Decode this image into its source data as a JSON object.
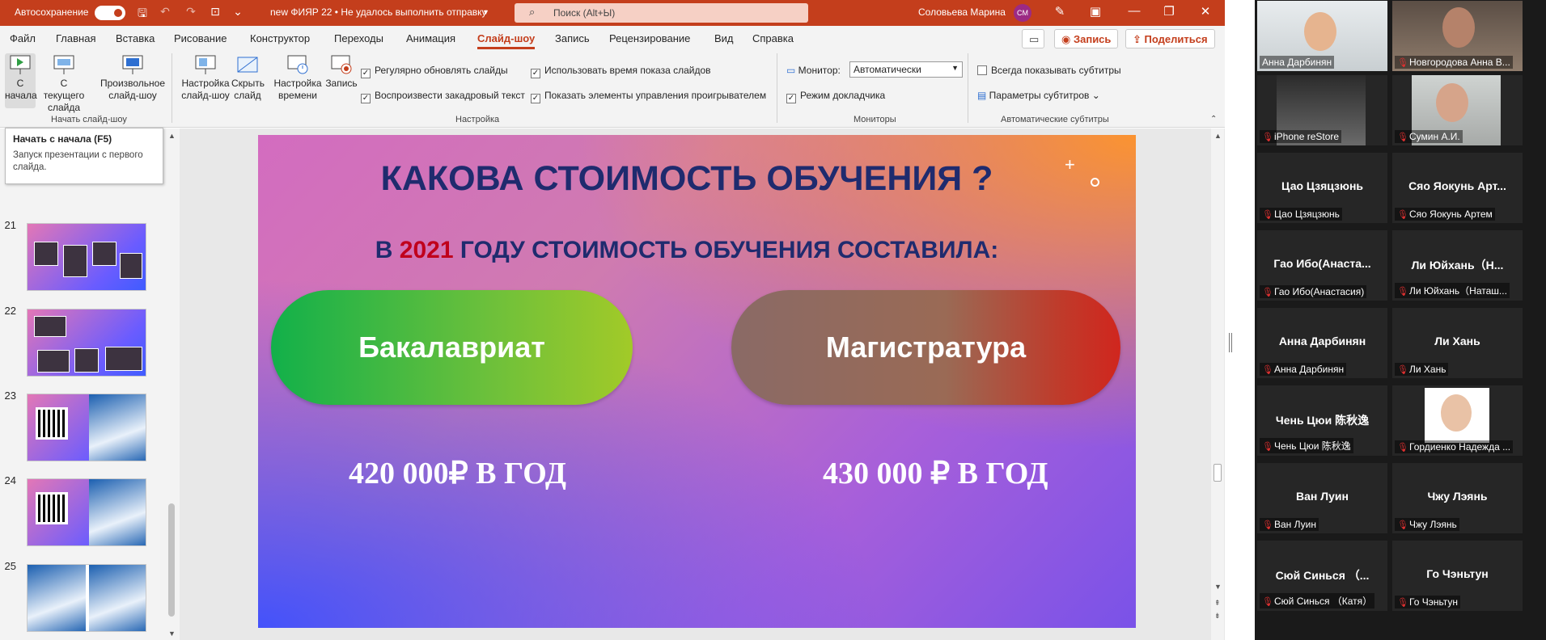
{
  "titlebar": {
    "autosave_label": "Автосохранение",
    "doc_title": "new ФИЯР 22 • Не удалось выполнить отправку",
    "search_placeholder": "Поиск (Alt+Ы)",
    "user_name": "Соловьева Марина",
    "user_initials": "СМ"
  },
  "menu": {
    "items": [
      "Файл",
      "Главная",
      "Вставка",
      "Рисование",
      "Конструктор",
      "Переходы",
      "Анимация",
      "Слайд-шоу",
      "Запись",
      "Рецензирование",
      "Вид",
      "Справка"
    ],
    "active": "Слайд-шоу",
    "record_button": "Запись",
    "share_button": "Поделиться"
  },
  "ribbon": {
    "from_start": "С начала",
    "from_current": "С текущего слайда",
    "custom_show": "Произвольное слайд-шоу",
    "setup_show": "Настройка слайд-шоу",
    "hide_slide": "Скрыть слайд",
    "rehearse": "Настройка времени",
    "record": "Запись",
    "checks": {
      "update_slides": "Регулярно обновлять слайды",
      "play_narration": "Воспроизвести закадровый текст",
      "use_timings": "Использовать время показа слайдов",
      "show_controls": "Показать элементы управления проигрывателем",
      "presenter_view": "Режим докладчика",
      "always_subtitles": "Всегда показывать субтитры"
    },
    "monitor_label": "Монитор:",
    "monitor_value": "Автоматически",
    "subtitle_settings": "Параметры субтитров",
    "groups": {
      "start": "Начать слайд-шоу",
      "setup": "Настройка",
      "monitors": "Мониторы",
      "captions": "Автоматические субтитры"
    }
  },
  "tooltip": {
    "title": "Начать с начала (F5)",
    "desc": "Запуск презентации с первого слайда."
  },
  "thumbnails": {
    "numbers": [
      "21",
      "22",
      "23",
      "24",
      "25"
    ]
  },
  "slide": {
    "title": "КАКОВА СТОИМОСТЬ ОБУЧЕНИЯ ?",
    "subtitle_pre": "В ",
    "subtitle_year": "2021",
    "subtitle_post": " ГОДУ СТОИМОСТЬ ОБУЧЕНИЯ СОСТАВИЛА:",
    "left_pill": "Бакалавриат",
    "right_pill": "Магистратура",
    "left_price": "420 000₽ В ГОД",
    "right_price": "430 000 ₽ В ГОД"
  },
  "participants": [
    {
      "center": "",
      "label": "Анна Дарбинян",
      "video": true,
      "muted": false
    },
    {
      "center": "",
      "label": "Новгородова Анна В...",
      "video": true,
      "muted": true
    },
    {
      "center": "",
      "label": "iPhone reStore",
      "video": true,
      "muted": true
    },
    {
      "center": "",
      "label": "Сумин А.И.",
      "video": true,
      "muted": true
    },
    {
      "center": "Цао Цзяцзюнь",
      "label": "Цао Цзяцзюнь",
      "video": false,
      "muted": true
    },
    {
      "center": "Сяо Яокунь Арт...",
      "label": "Сяо Яокунь Артем",
      "video": false,
      "muted": true
    },
    {
      "center": "Гао Ибо(Анаста...",
      "label": "Гао Ибо(Анастасия)",
      "video": false,
      "muted": true
    },
    {
      "center": "Ли Юйхань（Н...",
      "label": "Ли Юйхань（Наташ...",
      "video": false,
      "muted": true
    },
    {
      "center": "Анна Дарбинян",
      "label": "Анна Дарбинян",
      "video": false,
      "muted": true
    },
    {
      "center": "Ли Хань",
      "label": "Ли Хань",
      "video": false,
      "muted": true
    },
    {
      "center": "Чень Цюи 陈秋逸",
      "label": "Чень Цюи 陈秋逸",
      "video": false,
      "muted": true
    },
    {
      "center": "",
      "label": "Гордиенко Надежда ...",
      "video": true,
      "muted": true
    },
    {
      "center": "Ван Луин",
      "label": "Ван Луин",
      "video": false,
      "muted": true
    },
    {
      "center": "Чжу Лэянь",
      "label": "Чжу Лэянь",
      "video": false,
      "muted": true
    },
    {
      "center": "Сюй Синься （...",
      "label": "Сюй Синься （Катя）",
      "video": false,
      "muted": true
    },
    {
      "center": "Го Чэньтун",
      "label": "Го Чэньтун",
      "video": false,
      "muted": true
    }
  ],
  "colors": {
    "accent": "#c43e1c",
    "active_speaker": "#c6ff00",
    "slide_title": "#1f2b6e",
    "year": "#c0001c"
  }
}
